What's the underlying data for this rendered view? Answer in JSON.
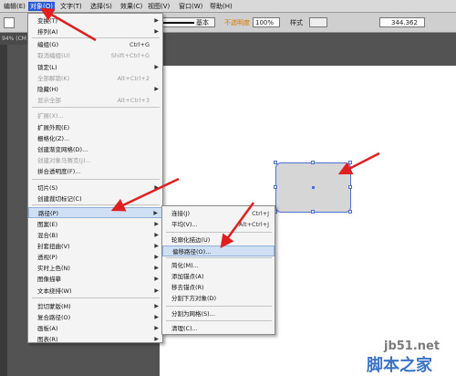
{
  "menubar": {
    "items": [
      "编辑(E)",
      "对象(O)",
      "文字(T)",
      "选择(S)",
      "效果(C)",
      "视图(V)",
      "窗口(W)",
      "帮助(H)"
    ]
  },
  "controlbar": {
    "stroke_style": "基本",
    "opacity_label": "不透明度",
    "opacity_value": "100%",
    "style_label": "样式",
    "width_value": "344.362"
  },
  "document_tab": "94% (CM",
  "object_menu": [
    {
      "label": "变换(T)",
      "shortcut": "",
      "submenu": true,
      "disabled": false
    },
    {
      "label": "排列(A)",
      "shortcut": "",
      "submenu": true,
      "disabled": false
    },
    {
      "label": "编组(G)",
      "shortcut": "Ctrl+G",
      "submenu": false,
      "disabled": false
    },
    {
      "label": "取消编组(U)",
      "shortcut": "Shift+Ctrl+G",
      "submenu": false,
      "disabled": true
    },
    {
      "label": "锁定(L)",
      "shortcut": "",
      "submenu": true,
      "disabled": false
    },
    {
      "label": "全部解锁(K)",
      "shortcut": "Alt+Ctrl+2",
      "submenu": false,
      "disabled": true
    },
    {
      "label": "隐藏(H)",
      "shortcut": "",
      "submenu": true,
      "disabled": false
    },
    {
      "label": "显示全部",
      "shortcut": "Alt+Ctrl+3",
      "submenu": false,
      "disabled": true
    },
    {
      "label": "扩展(X)...",
      "shortcut": "",
      "submenu": false,
      "disabled": true
    },
    {
      "label": "扩展外观(E)",
      "shortcut": "",
      "submenu": false,
      "disabled": false
    },
    {
      "label": "栅格化(Z)...",
      "shortcut": "",
      "submenu": false,
      "disabled": false
    },
    {
      "label": "创建渐变网格(D)...",
      "shortcut": "",
      "submenu": false,
      "disabled": false
    },
    {
      "label": "创建对象马赛克(J)...",
      "shortcut": "",
      "submenu": false,
      "disabled": true
    },
    {
      "label": "拼合透明度(F)...",
      "shortcut": "",
      "submenu": false,
      "disabled": false
    },
    {
      "label": "切片(S)",
      "shortcut": "",
      "submenu": true,
      "disabled": false
    },
    {
      "label": "创建裁切标记(C)",
      "shortcut": "",
      "submenu": false,
      "disabled": false
    },
    {
      "label": "路径(P)",
      "shortcut": "",
      "submenu": true,
      "disabled": false
    },
    {
      "label": "图案(E)",
      "shortcut": "",
      "submenu": true,
      "disabled": false
    },
    {
      "label": "混合(B)",
      "shortcut": "",
      "submenu": true,
      "disabled": false
    },
    {
      "label": "封套扭曲(V)",
      "shortcut": "",
      "submenu": true,
      "disabled": false
    },
    {
      "label": "透视(P)",
      "shortcut": "",
      "submenu": true,
      "disabled": false
    },
    {
      "label": "实时上色(N)",
      "shortcut": "",
      "submenu": true,
      "disabled": false
    },
    {
      "label": "图像描摹",
      "shortcut": "",
      "submenu": true,
      "disabled": false
    },
    {
      "label": "文本绕排(W)",
      "shortcut": "",
      "submenu": true,
      "disabled": false
    },
    {
      "label": "剪切蒙版(M)",
      "shortcut": "",
      "submenu": true,
      "disabled": false
    },
    {
      "label": "复合路径(O)",
      "shortcut": "",
      "submenu": true,
      "disabled": false
    },
    {
      "label": "画板(A)",
      "shortcut": "",
      "submenu": true,
      "disabled": false
    },
    {
      "label": "图表(R)",
      "shortcut": "",
      "submenu": true,
      "disabled": false
    }
  ],
  "path_submenu": [
    {
      "label": "连接(J)",
      "shortcut": "Ctrl+J"
    },
    {
      "label": "平均(V)...",
      "shortcut": "Alt+Ctrl+J"
    },
    {
      "label": "轮廓化描边(U)",
      "shortcut": ""
    },
    {
      "label": "偏移路径(O)...",
      "shortcut": ""
    },
    {
      "label": "简化(M)...",
      "shortcut": ""
    },
    {
      "label": "添加锚点(A)",
      "shortcut": ""
    },
    {
      "label": "移去锚点(R)",
      "shortcut": ""
    },
    {
      "label": "分割下方对象(D)",
      "shortcut": ""
    },
    {
      "label": "分割为网格(S)...",
      "shortcut": ""
    },
    {
      "label": "清理(C)...",
      "shortcut": ""
    }
  ],
  "watermark": {
    "domain": "jb51.net",
    "brand": "脚本之家"
  },
  "colors": {
    "menu_highlight": "#cfe0f5",
    "active_menu": "#2a5bd7",
    "arrow": "#e02020",
    "selection": "#4d6fcf"
  }
}
